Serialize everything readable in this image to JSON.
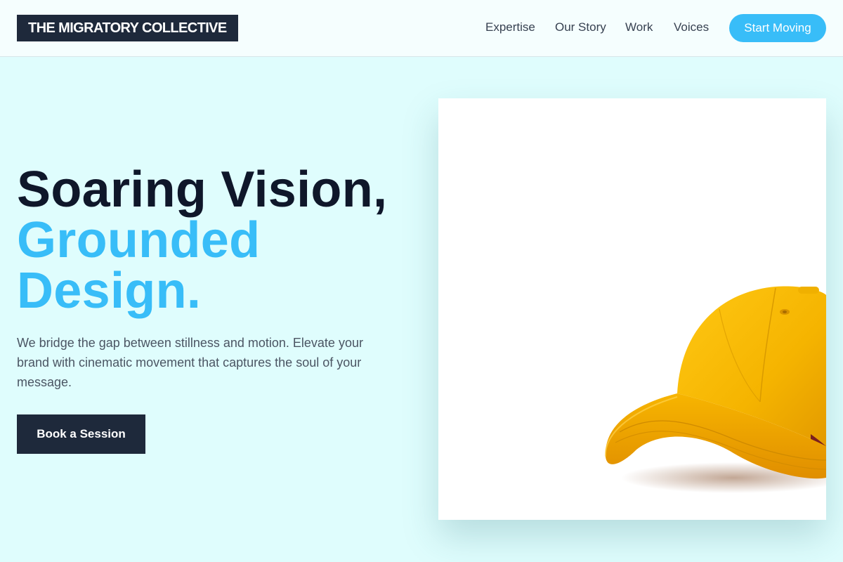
{
  "brand": {
    "name": "THE MIGRATORY COLLECTIVE"
  },
  "nav": {
    "items": [
      "Expertise",
      "Our Story",
      "Work",
      "Voices"
    ],
    "cta": "Start Moving"
  },
  "hero": {
    "line1": "Soaring Vision,",
    "line2": "Grounded",
    "line3": "Design.",
    "description": "We bridge the gap between stillness and motion. Elevate your brand with cinematic movement that captures the soul of your message.",
    "button": "Book a Session"
  },
  "colors": {
    "accent": "#38bdf8",
    "dark": "#1e293b",
    "background": "#dffdfd",
    "cap": "#f5b400"
  }
}
